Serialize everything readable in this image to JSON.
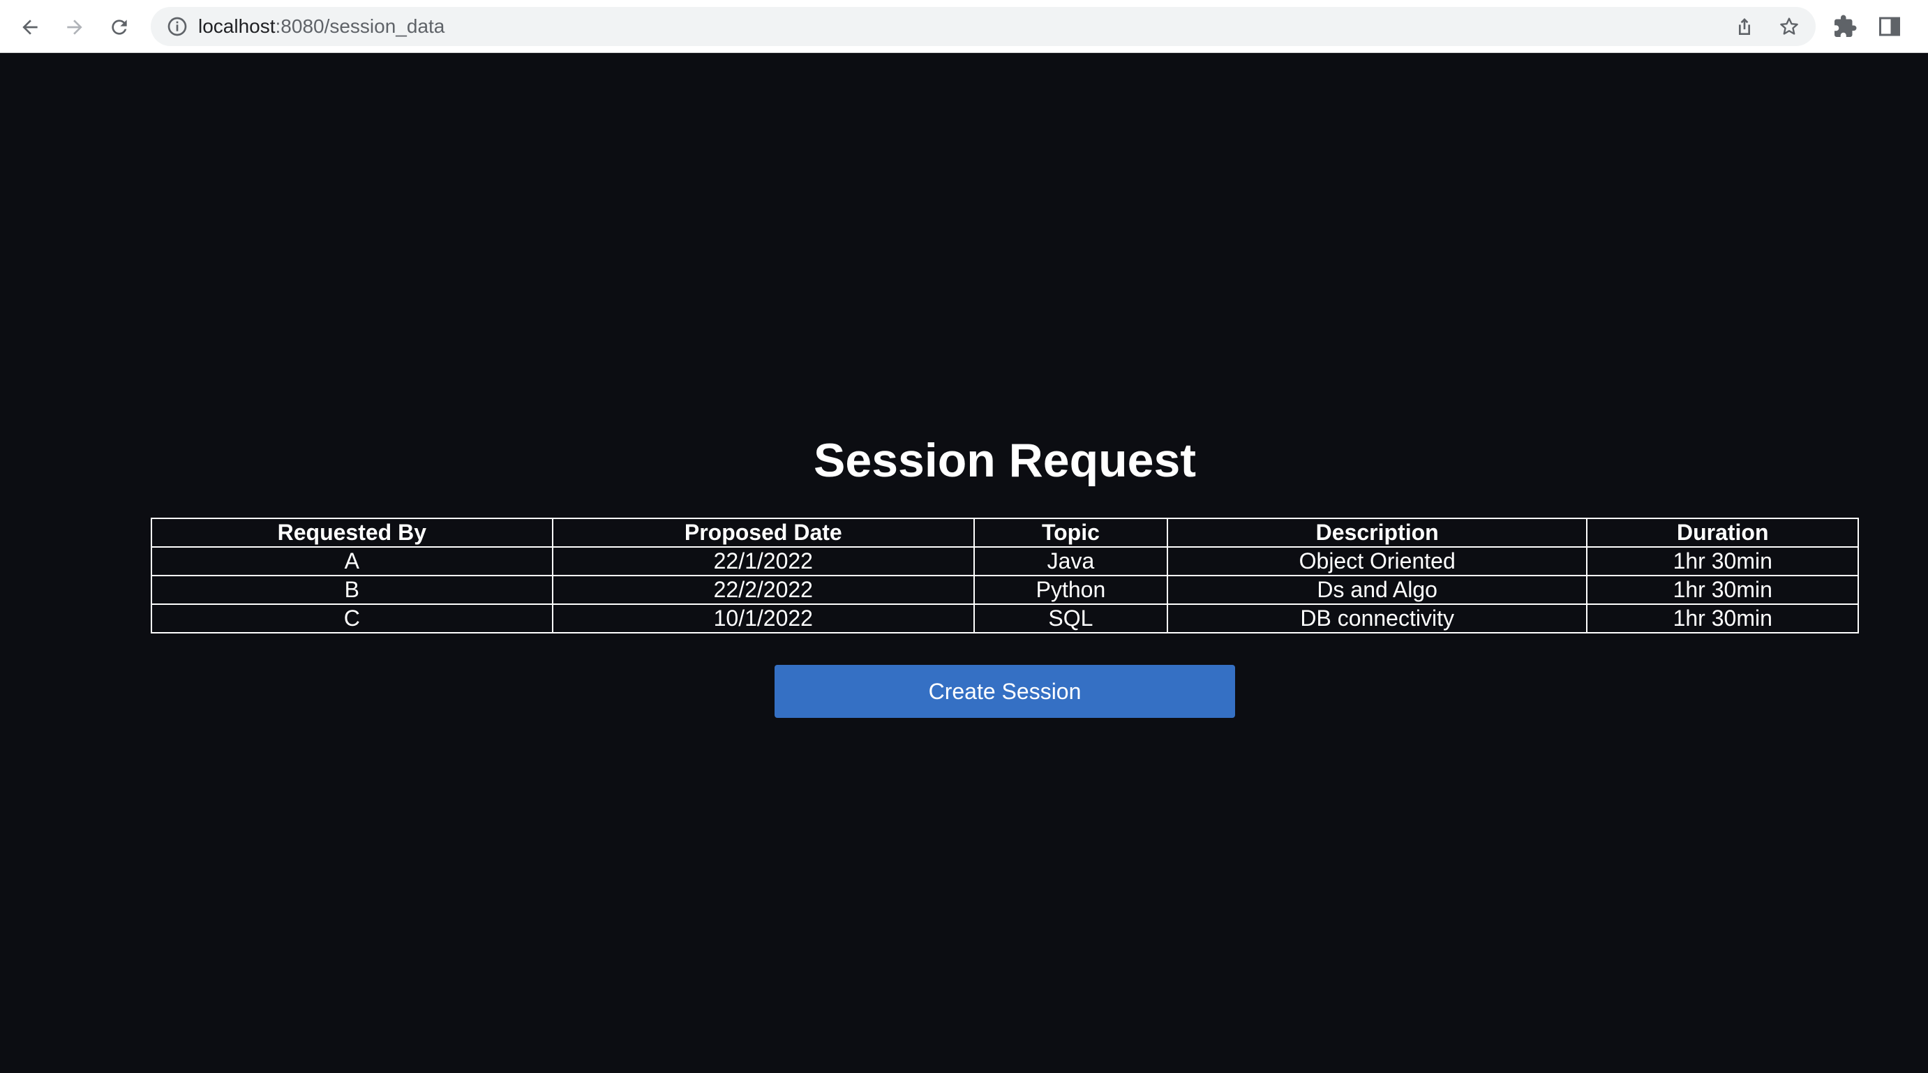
{
  "browser": {
    "url_host": "localhost",
    "url_path": ":8080/session_data"
  },
  "page": {
    "title": "Session Request",
    "table": {
      "headers": [
        "Requested By",
        "Proposed Date",
        "Topic",
        "Description",
        "Duration"
      ],
      "rows": [
        [
          "A",
          "22/1/2022",
          "Java",
          "Object Oriented",
          "1hr 30min"
        ],
        [
          "B",
          "22/2/2022",
          "Python",
          "Ds and Algo",
          "1hr 30min"
        ],
        [
          "C",
          "10/1/2022",
          "SQL",
          "DB connectivity",
          "1hr 30min"
        ]
      ]
    },
    "create_button_label": "Create Session"
  },
  "colors": {
    "background": "#0c0d12",
    "button": "#3570c4",
    "table_border": "#ffffff"
  },
  "icons": [
    "back-arrow-icon",
    "forward-arrow-icon",
    "reload-icon",
    "info-icon",
    "share-icon",
    "star-icon",
    "extensions-icon",
    "side-panel-icon"
  ]
}
